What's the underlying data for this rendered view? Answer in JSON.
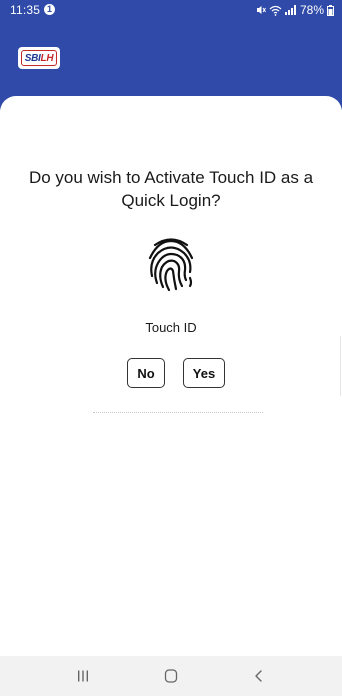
{
  "status_bar": {
    "time": "11:35",
    "notification_badge": "1",
    "battery_percent": "78%"
  },
  "header": {
    "logo_text_primary": "SBI",
    "logo_text_secondary": "LH",
    "background_color": "#2f4aa8"
  },
  "dialog": {
    "question": "Do you wish to Activate Touch ID as a Quick Login?",
    "icon": "fingerprint-icon",
    "icon_label": "Touch ID",
    "no_label": "No",
    "yes_label": "Yes"
  },
  "nav_bar": {
    "recent_icon": "recent-apps-icon",
    "home_icon": "home-icon",
    "back_icon": "back-icon"
  }
}
